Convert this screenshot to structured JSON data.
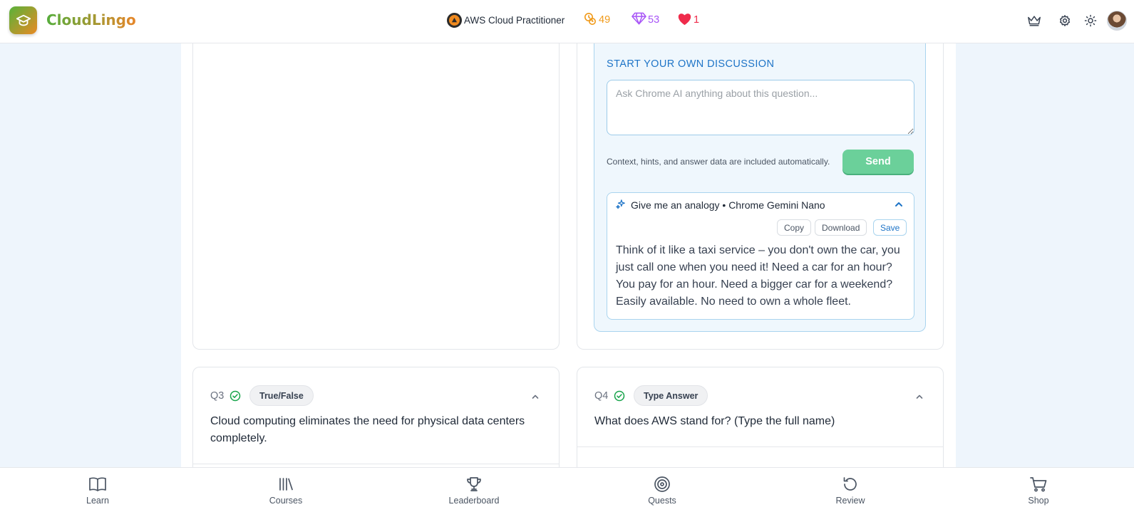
{
  "app": {
    "brand": "CloudLingo",
    "course_name": "AWS Cloud Practitioner",
    "stats": {
      "streak": "49",
      "gems": "53",
      "hearts": "1"
    },
    "colors": {
      "accent": "#1e74c7",
      "send": "#6bd09a",
      "streak": "#f09a1a",
      "gems": "#a855f7",
      "hearts": "#ef2b4b"
    }
  },
  "discussion": {
    "title": "START YOUR OWN DISCUSSION",
    "placeholder": "Ask Chrome AI anything about this question...",
    "hint": "Context, hints, and answer data are included automatically.",
    "send_label": "Send",
    "answer": {
      "heading": "Give me an analogy • Chrome Gemini Nano",
      "copy_label": "Copy",
      "download_label": "Download",
      "save_label": "Save",
      "body": "Think of it like a taxi service – you don't own the car, you just call one when you need it! Need a car for an hour? You pay for an hour. Need a bigger car for a weekend? Easily available. No need to own a whole fleet."
    }
  },
  "questions": [
    {
      "number": "Q3",
      "type": "True/False",
      "text": "Cloud computing eliminates the need for physical data centers completely."
    },
    {
      "number": "Q4",
      "type": "Type Answer",
      "text": "What does AWS stand for? (Type the full name)"
    }
  ],
  "bottom_nav": [
    {
      "label": "Learn",
      "icon": "book-icon"
    },
    {
      "label": "Courses",
      "icon": "library-icon"
    },
    {
      "label": "Leaderboard",
      "icon": "trophy-icon"
    },
    {
      "label": "Quests",
      "icon": "target-icon"
    },
    {
      "label": "Review",
      "icon": "history-icon"
    },
    {
      "label": "Shop",
      "icon": "cart-icon"
    }
  ]
}
